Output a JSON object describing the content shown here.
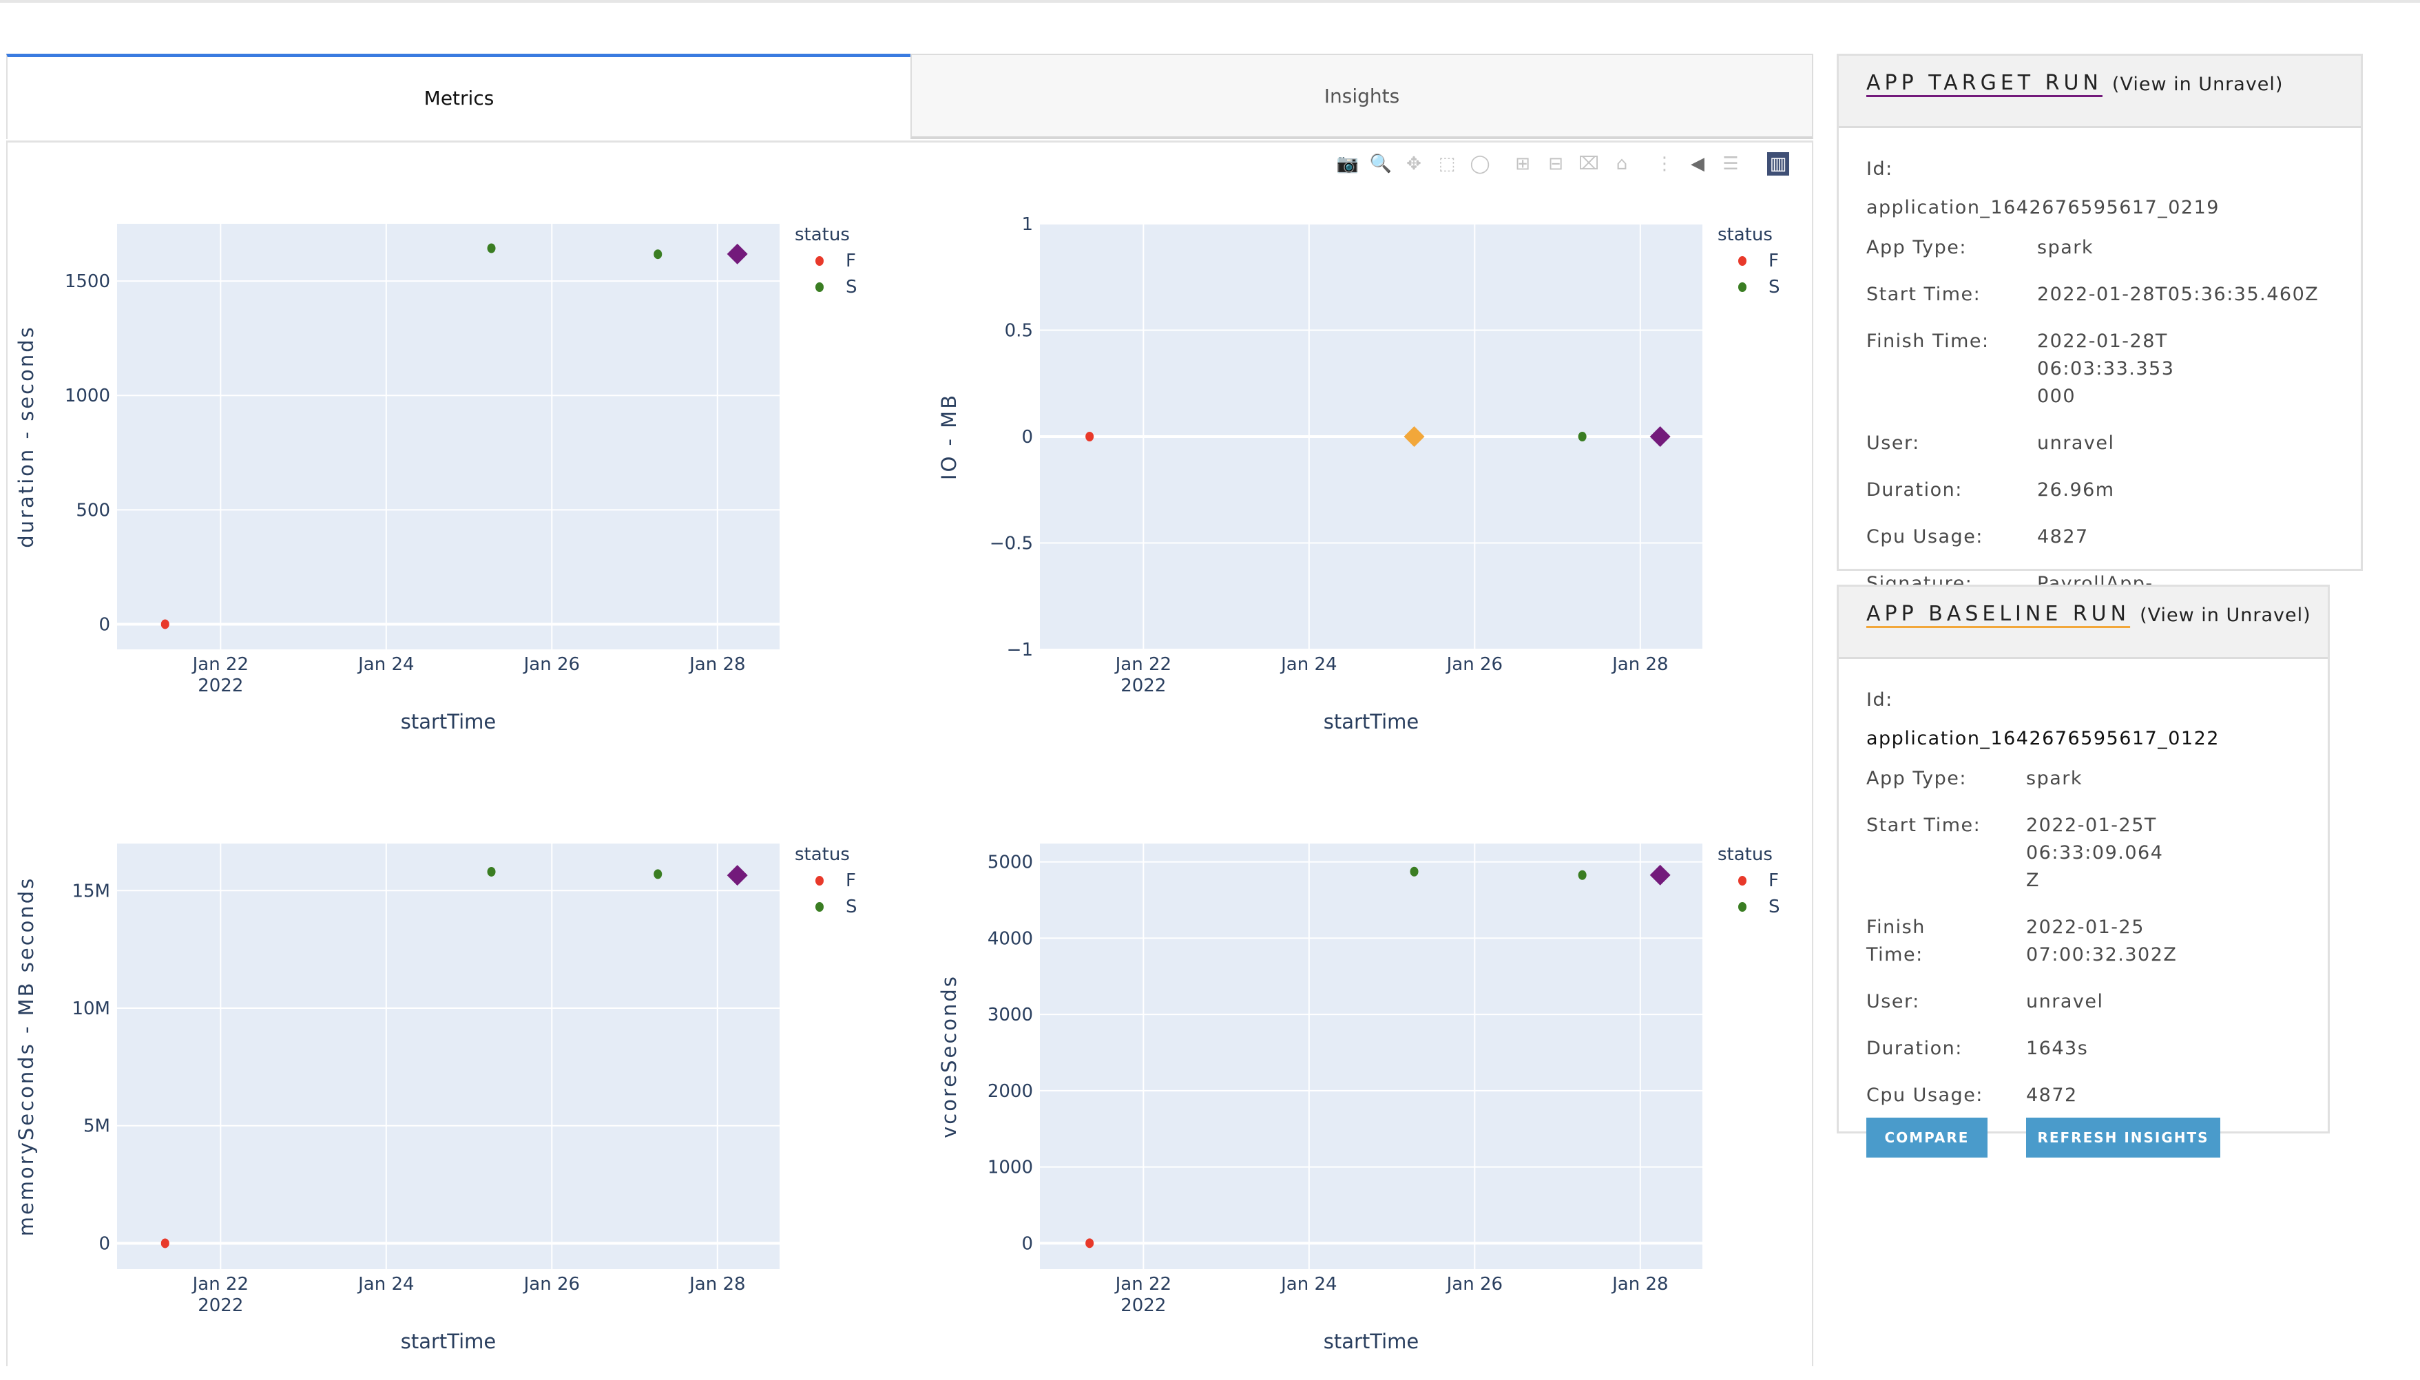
{
  "tabs": [
    {
      "label": "Metrics",
      "active": true
    },
    {
      "label": "Insights",
      "active": false
    }
  ],
  "toolbar": {
    "icons": [
      "camera-icon",
      "zoom-icon",
      "pan-icon",
      "box-select-icon",
      "lasso-select-icon",
      "zoom-in-icon",
      "zoom-out-icon",
      "autoscale-icon",
      "reset-axes-icon",
      "spike-lines-icon",
      "hover-closest-icon",
      "hover-compare-icon",
      "plotly-logo-icon"
    ]
  },
  "colors": {
    "status_F": "#e8392a",
    "status_S": "#3a7d22",
    "target": "#731a7b",
    "baseline": "#f2a73a",
    "plot_bg": "#e5ecf6",
    "button": "#4a9bcb",
    "tab_accent": "#3a7be0"
  },
  "chart_data": [
    {
      "type": "scatter",
      "title": "",
      "xlabel": "startTime",
      "ylabel": "duration - seconds",
      "x_ticks": [
        "Jan 22\n2022",
        "Jan 24",
        "Jan 26",
        "Jan 28"
      ],
      "x_tick_days": [
        22,
        24,
        26,
        28
      ],
      "xlim_days": [
        20.75,
        28.75
      ],
      "y_ticks": [
        "0",
        "500",
        "1000",
        "1500"
      ],
      "y_tick_values": [
        0,
        500,
        1000,
        1500
      ],
      "ylim": [
        -110,
        1750
      ],
      "legend": {
        "title": "status",
        "entries": [
          "F",
          "S"
        ],
        "placement": "top-right-outside"
      },
      "series": [
        {
          "name": "F",
          "points": [
            {
              "day": 21.33,
              "y": 0
            }
          ]
        },
        {
          "name": "S",
          "points": [
            {
              "day": 25.27,
              "y": 1643
            },
            {
              "day": 27.28,
              "y": 1617
            }
          ]
        },
        {
          "name": "target",
          "marker": "diamond",
          "points": [
            {
              "day": 28.24,
              "y": 1618
            }
          ]
        }
      ]
    },
    {
      "type": "scatter",
      "title": "",
      "xlabel": "startTime",
      "ylabel": "IO - MB",
      "x_ticks": [
        "Jan 22\n2022",
        "Jan 24",
        "Jan 26",
        "Jan 28"
      ],
      "x_tick_days": [
        22,
        24,
        26,
        28
      ],
      "xlim_days": [
        20.75,
        28.75
      ],
      "y_ticks": [
        "−1",
        "−0.5",
        "0",
        "0.5",
        "1"
      ],
      "y_tick_values": [
        -1,
        -0.5,
        0,
        0.5,
        1
      ],
      "ylim": [
        -1,
        1
      ],
      "legend": {
        "title": "status",
        "entries": [
          "F",
          "S"
        ],
        "placement": "top-right-outside"
      },
      "series": [
        {
          "name": "F",
          "points": [
            {
              "day": 21.35,
              "y": 0
            }
          ]
        },
        {
          "name": "S",
          "points": [
            {
              "day": 27.3,
              "y": 0
            }
          ]
        },
        {
          "name": "baseline",
          "marker": "diamond",
          "points": [
            {
              "day": 25.27,
              "y": 0
            }
          ]
        },
        {
          "name": "target",
          "marker": "diamond",
          "points": [
            {
              "day": 28.24,
              "y": 0
            }
          ]
        }
      ]
    },
    {
      "type": "scatter",
      "title": "",
      "xlabel": "startTime",
      "ylabel": "memorySeconds - MB seconds",
      "x_ticks": [
        "Jan 22\n2022",
        "Jan 24",
        "Jan 26",
        "Jan 28"
      ],
      "x_tick_days": [
        22,
        24,
        26,
        28
      ],
      "xlim_days": [
        20.75,
        28.75
      ],
      "y_ticks": [
        "0",
        "5M",
        "10M",
        "15M"
      ],
      "y_tick_values": [
        0,
        5000000,
        10000000,
        15000000
      ],
      "ylim": [
        -1100000,
        17000000
      ],
      "legend": {
        "title": "status",
        "entries": [
          "F",
          "S"
        ],
        "placement": "top-right-outside"
      },
      "series": [
        {
          "name": "F",
          "points": [
            {
              "day": 21.33,
              "y": 0
            }
          ]
        },
        {
          "name": "S",
          "points": [
            {
              "day": 25.27,
              "y": 15800000
            },
            {
              "day": 27.28,
              "y": 15700000
            }
          ]
        },
        {
          "name": "target",
          "marker": "diamond",
          "points": [
            {
              "day": 28.24,
              "y": 15650000
            }
          ]
        }
      ]
    },
    {
      "type": "scatter",
      "title": "",
      "xlabel": "startTime",
      "ylabel": "vcoreSeconds",
      "x_ticks": [
        "Jan 22\n2022",
        "Jan 24",
        "Jan 26",
        "Jan 28"
      ],
      "x_tick_days": [
        22,
        24,
        26,
        28
      ],
      "xlim_days": [
        20.75,
        28.75
      ],
      "y_ticks": [
        "0",
        "1000",
        "2000",
        "3000",
        "4000",
        "5000"
      ],
      "y_tick_values": [
        0,
        1000,
        2000,
        3000,
        4000,
        5000
      ],
      "ylim": [
        -340,
        5240
      ],
      "legend": {
        "title": "status",
        "entries": [
          "F",
          "S"
        ],
        "placement": "top-right-outside"
      },
      "series": [
        {
          "name": "F",
          "points": [
            {
              "day": 21.35,
              "y": 0
            }
          ]
        },
        {
          "name": "S",
          "points": [
            {
              "day": 25.27,
              "y": 4872
            },
            {
              "day": 27.3,
              "y": 4827
            }
          ]
        },
        {
          "name": "target",
          "marker": "diamond",
          "points": [
            {
              "day": 28.24,
              "y": 4827
            }
          ]
        }
      ]
    }
  ],
  "target_run": {
    "title": "APP TARGET RUN",
    "view_link": "(View in Unravel)",
    "underline_color": "#731a7b",
    "id_label": "Id:",
    "id_value": "application_1642676595617_0219",
    "fields": [
      {
        "label": "App Type:",
        "value": "spark"
      },
      {
        "label": "Start Time:",
        "value": "2022-01-28T05:36:35.460Z"
      },
      {
        "label": "Finish Time:",
        "value": "2022-01-28T06:03:33.353000"
      },
      {
        "label": "User:",
        "value": "unravel"
      },
      {
        "label": "Duration:",
        "value": "26.96m"
      },
      {
        "label": "Cpu Usage:",
        "value": "4827"
      },
      {
        "label": "Signature:",
        "value": "PayrollApp-memoryOverhead"
      }
    ]
  },
  "baseline_run": {
    "title": "APP BASELINE RUN",
    "view_link": "(View in Unravel)",
    "underline_color": "#f2a73a",
    "id_label": "Id:",
    "id_value": "application_1642676595617_0122",
    "fields": [
      {
        "label": "App Type:",
        "value": "spark"
      },
      {
        "label": "Start Time:",
        "value": "2022-01-25T06:33:09.064Z"
      },
      {
        "label": "Finish Time:",
        "value": "2022-01-25 07:00:32.302Z"
      },
      {
        "label": "User:",
        "value": "unravel"
      },
      {
        "label": "Duration:",
        "value": "1643s"
      },
      {
        "label": "Cpu Usage:",
        "value": "4872"
      }
    ],
    "buttons": {
      "compare": "COMPARE",
      "refresh": "REFRESH INSIGHTS"
    }
  }
}
